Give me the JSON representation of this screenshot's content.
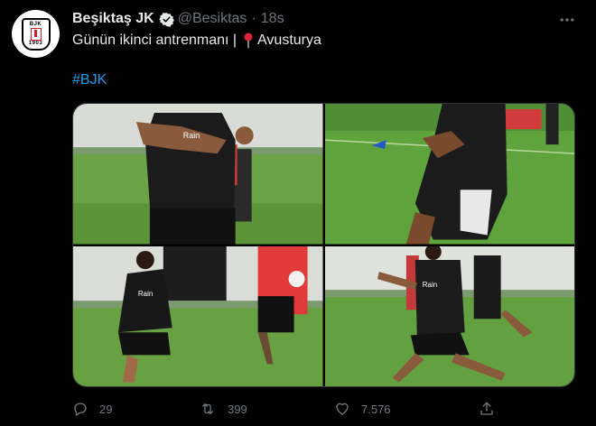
{
  "tweet": {
    "display_name": "Beşiktaş JK",
    "handle": "@Besiktas",
    "separator": "·",
    "time": "18s",
    "text_before": "Günün ikinci antrenmanı |",
    "text_after": "Avusturya",
    "hashtag": "#BJK"
  },
  "avatar": {
    "crest_top": "BJK",
    "crest_bottom": "1903"
  },
  "photos": [
    {
      "icon": "photo-training-1",
      "jersey_text": "Rain"
    },
    {
      "icon": "photo-training-2"
    },
    {
      "icon": "photo-training-3",
      "jersey_text": "Rain"
    },
    {
      "icon": "photo-training-4",
      "jersey_text": "Rain"
    }
  ],
  "actions": {
    "replies": "29",
    "retweets": "399",
    "likes": "7.576"
  },
  "colors": {
    "background": "#000000",
    "text": "#e7e9ea",
    "muted": "#71767b",
    "link": "#1d9bf0",
    "verified": "#1d9bf0",
    "pitch": "#5a9a3c"
  }
}
